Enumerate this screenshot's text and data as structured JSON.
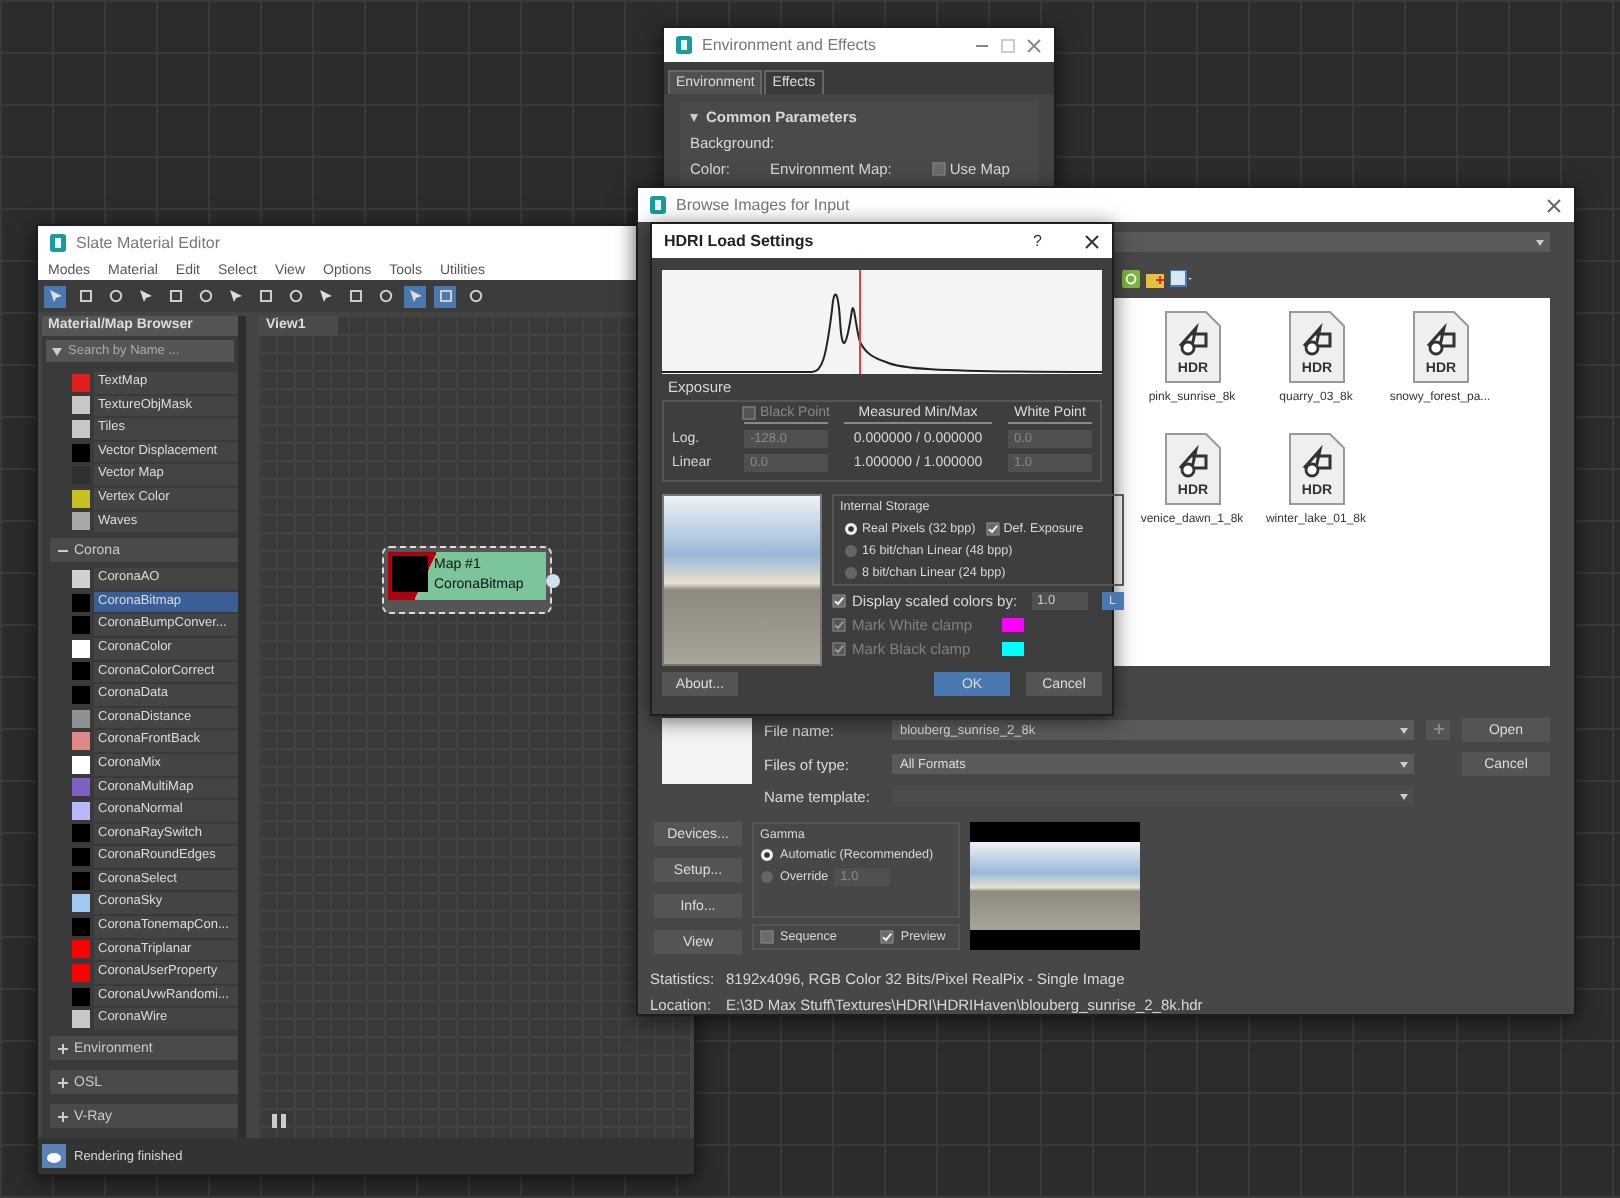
{
  "slate_editor": {
    "title": "Slate Material Editor",
    "menu": [
      "Modes",
      "Material",
      "Edit",
      "Select",
      "View",
      "Options",
      "Tools",
      "Utilities"
    ],
    "browser": {
      "title": "Material/Map Browser",
      "search": {
        "placeholder": "Search by Name ..."
      },
      "items": [
        {
          "name": "TextMap",
          "color": "#e02020",
          "selected": false
        },
        {
          "name": "TextureObjMask",
          "color": "#c8c8c8",
          "selected": false
        },
        {
          "name": "Tiles",
          "color": "#c8c8c8",
          "selected": false
        },
        {
          "name": "Vector Displacement",
          "color": "#000000",
          "selected": false
        },
        {
          "name": "Vector Map",
          "color": "#303030",
          "selected": false
        },
        {
          "name": "Vertex Color",
          "color": "#c8c020",
          "selected": false
        },
        {
          "name": "Waves",
          "color": "#a8a8a8",
          "selected": false
        }
      ],
      "groups": [
        {
          "label": "Corona",
          "expanded": true,
          "items": [
            {
              "name": "CoronaAO",
              "color": "#d0d0d0",
              "selected": false
            },
            {
              "name": "CoronaBitmap",
              "color": "#000000",
              "selected": true
            },
            {
              "name": "CoronaBumpConver...",
              "color": "#000000",
              "selected": false
            },
            {
              "name": "CoronaColor",
              "color": "#ffffff",
              "selected": false
            },
            {
              "name": "CoronaColorCorrect",
              "color": "#000000",
              "selected": false
            },
            {
              "name": "CoronaData",
              "color": "#000000",
              "selected": false
            },
            {
              "name": "CoronaDistance",
              "color": "#909090",
              "selected": false
            },
            {
              "name": "CoronaFrontBack",
              "color": "#e08888",
              "selected": false
            },
            {
              "name": "CoronaMix",
              "color": "#ffffff",
              "selected": false
            },
            {
              "name": "CoronaMultiMap",
              "color": "#8060c0",
              "selected": false
            },
            {
              "name": "CoronaNormal",
              "color": "#b8b8ff",
              "selected": false
            },
            {
              "name": "CoronaRaySwitch",
              "color": "#000000",
              "selected": false
            },
            {
              "name": "CoronaRoundEdges",
              "color": "#000000",
              "selected": false
            },
            {
              "name": "CoronaSelect",
              "color": "#000000",
              "selected": false
            },
            {
              "name": "CoronaSky",
              "color": "#a0c8f0",
              "selected": false
            },
            {
              "name": "CoronaTonemapCon...",
              "color": "#000000",
              "selected": false
            },
            {
              "name": "CoronaTriplanar",
              "color": "#ff0000",
              "selected": false
            },
            {
              "name": "CoronaUserProperty",
              "color": "#ff0000",
              "selected": false
            },
            {
              "name": "CoronaUvwRandomi...",
              "color": "#000000",
              "selected": false
            },
            {
              "name": "CoronaWire",
              "color": "#c8c8c8",
              "selected": false
            }
          ]
        },
        {
          "label": "Environment",
          "expanded": false
        },
        {
          "label": "OSL",
          "expanded": false
        },
        {
          "label": "V-Ray",
          "expanded": false
        }
      ]
    },
    "view_tab": "View1",
    "node": {
      "title": "Map #1",
      "type": "CoronaBitmap"
    },
    "status": "Rendering finished"
  },
  "environment_window": {
    "title": "Environment and Effects",
    "tabs": [
      {
        "label": "Environment",
        "selected": true
      },
      {
        "label": "Effects",
        "selected": false
      }
    ],
    "rollout": "Common Parameters",
    "background_label": "Background:",
    "color_label": "Color:",
    "environment_map_label": "Environment Map:",
    "use_map": {
      "label": "Use Map",
      "checked": false
    }
  },
  "browse_window": {
    "title": "Browse Images for Input",
    "files": [
      {
        "name": "pink_sunrise_8k",
        "type": "HDR"
      },
      {
        "name": "quarry_03_8k",
        "type": "HDR"
      },
      {
        "name": "snowy_forest_pa...",
        "type": "HDR"
      },
      {
        "name": "venice_dawn_1_8k",
        "type": "HDR"
      },
      {
        "name": "winter_lake_01_8k",
        "type": "HDR"
      }
    ],
    "file_name": {
      "label": "File name:",
      "value": "blouberg_sunrise_2_8k"
    },
    "file_type": {
      "label": "Files of type:",
      "value": "All Formats"
    },
    "name_template": {
      "label": "Name template:"
    },
    "buttons": [
      "Open",
      "Cancel"
    ],
    "side_buttons": [
      "Devices...",
      "Setup...",
      "Info...",
      "View"
    ],
    "gamma": {
      "title": "Gamma",
      "options": [
        {
          "label": "Automatic (Recommended)",
          "selected": true
        },
        {
          "label": "Override",
          "selected": false
        }
      ],
      "override_value": "1.0"
    },
    "sequence": {
      "label": "Sequence",
      "checked": false
    },
    "preview": {
      "label": "Preview",
      "checked": true
    },
    "statistics": {
      "label": "Statistics:",
      "value": "8192x4096, RGB Color 32 Bits/Pixel RealPix - Single Image"
    },
    "location": {
      "label": "Location:",
      "value": "E:\\3D Max Stuff\\Textures\\HDRI\\HDRIHaven\\blouberg_sunrise_2_8k.hdr"
    }
  },
  "hdri_window": {
    "title": "HDRI Load Settings",
    "help": "?",
    "exposure": {
      "title": "Exposure",
      "black_point": {
        "label": "Black Point",
        "checked": false
      },
      "measured_label": "Measured Min/Max",
      "white_point_label": "White Point",
      "rows": [
        {
          "label": "Log.",
          "black": "-128.0",
          "measured": "0.000000 / 0.000000",
          "white": "0.0"
        },
        {
          "label": "Linear",
          "black": "0.0",
          "measured": "1.000000 / 1.000000",
          "white": "1.0"
        }
      ]
    },
    "storage": {
      "title": "Internal Storage",
      "options": [
        {
          "label": "Real Pixels (32 bpp)",
          "selected": true
        },
        {
          "label": "16 bit/chan Linear (48 bpp)",
          "selected": false
        },
        {
          "label": "8 bit/chan Linear (24 bpp)",
          "selected": false
        }
      ],
      "def_exposure": {
        "label": "Def. Exposure",
        "checked": true
      }
    },
    "display_scaled": {
      "label": "Display scaled colors by:",
      "checked": true,
      "value": "1.0",
      "lock": "L"
    },
    "clamps": [
      {
        "label": "Mark White clamp",
        "checked": true,
        "disabled": true,
        "color": "#ff00ff"
      },
      {
        "label": "Mark Black clamp",
        "checked": true,
        "disabled": true,
        "color": "#00ffff"
      }
    ],
    "buttons": [
      {
        "label": "About...",
        "kind": "plain"
      },
      {
        "label": "OK",
        "kind": "primary"
      },
      {
        "label": "Cancel",
        "kind": "plain"
      }
    ]
  }
}
